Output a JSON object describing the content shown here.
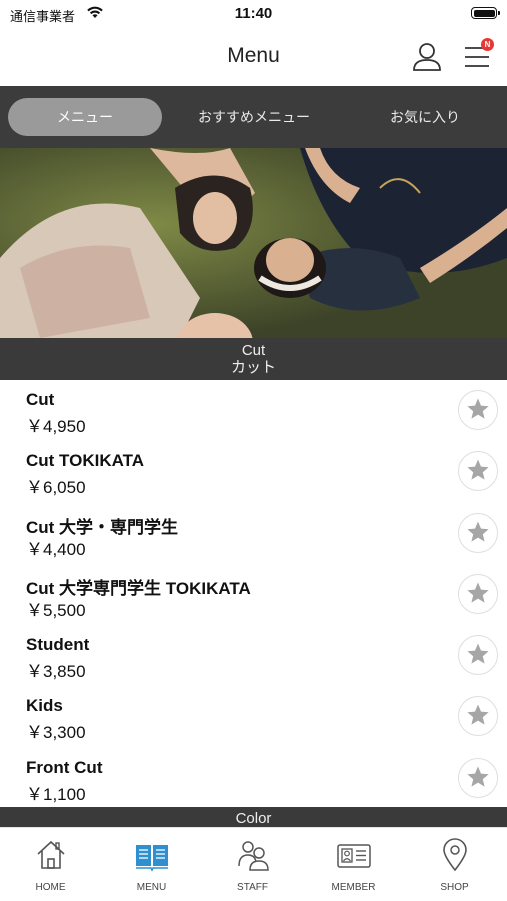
{
  "status_bar": {
    "carrier": "通信事業者",
    "time": "11:40"
  },
  "header": {
    "title": "Menu",
    "badge": "N"
  },
  "tabs": [
    {
      "label": "メニュー",
      "active": true
    },
    {
      "label": "おすすめメニュー",
      "active": false
    },
    {
      "label": "お気に入り",
      "active": false
    }
  ],
  "sections": {
    "cut": {
      "title_en": "Cut",
      "title_ja": "カット"
    },
    "color": {
      "title_en": "Color"
    }
  },
  "menu_items": [
    {
      "name": "Cut",
      "price": "￥4,950"
    },
    {
      "name": "Cut TOKIKATA",
      "price": "￥6,050"
    },
    {
      "name": "Cut 大学・専門学生",
      "price": "￥4,400"
    },
    {
      "name": "Cut 大学専門学生 TOKIKATA",
      "price": "￥5,500"
    },
    {
      "name": "Student",
      "price": "￥3,850"
    },
    {
      "name": "Kids",
      "price": "￥3,300"
    },
    {
      "name": "Front Cut",
      "price": "￥1,100"
    }
  ],
  "bottom_nav": [
    {
      "label": "HOME",
      "icon": "home-icon",
      "active": false
    },
    {
      "label": "MENU",
      "icon": "book-icon",
      "active": true
    },
    {
      "label": "STAFF",
      "icon": "staff-icon",
      "active": false
    },
    {
      "label": "MEMBER",
      "icon": "member-card-icon",
      "active": false
    },
    {
      "label": "SHOP",
      "icon": "location-pin-icon",
      "active": false
    }
  ],
  "colors": {
    "accent": "#2e8fd1",
    "tab_bar_bg": "#3c3c3c",
    "section_bg": "#3a3a3a",
    "badge": "#e53935"
  }
}
